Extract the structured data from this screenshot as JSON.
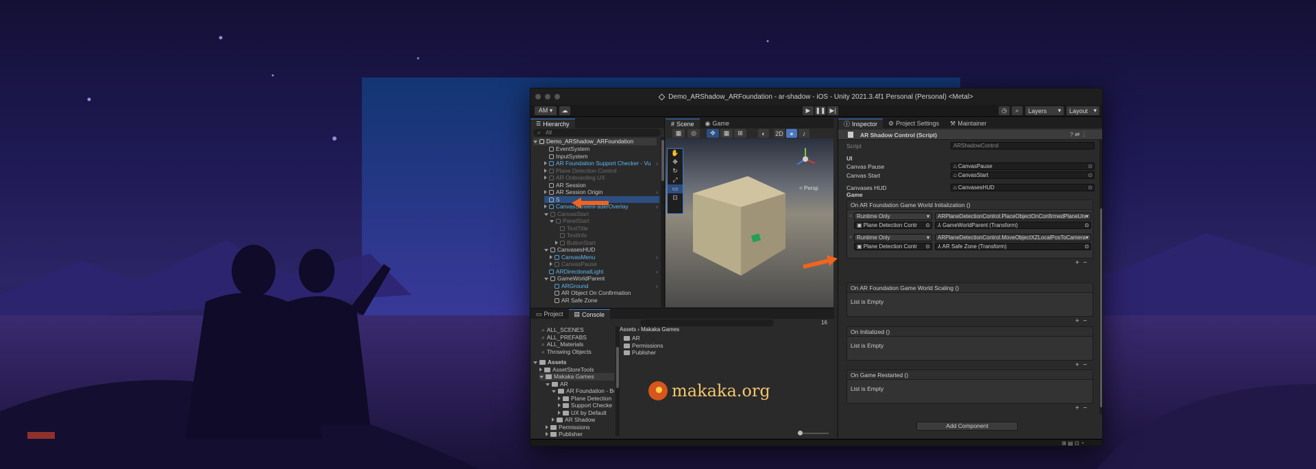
{
  "window": {
    "title": "Demo_ARShadow_ARFoundation - ar-shadow - iOS - Unity 2021.3.4f1 Personal (Personal) <Metal>"
  },
  "toolbar": {
    "account": "AM ▾",
    "layers": "Layers",
    "layout": "Layout"
  },
  "hierarchy": {
    "tab": "Hierarchy",
    "search": "All",
    "scene": "Demo_ARShadow_ARFoundation",
    "items": [
      {
        "label": "EventSystem"
      },
      {
        "label": "InputSystem"
      },
      {
        "label": "AR Foundation Support Checker - Vu"
      },
      {
        "label": "Plane Detection Control"
      },
      {
        "label": "AR Onboarding UX"
      },
      {
        "label": "AR Session"
      },
      {
        "label": "AR Session Origin"
      },
      {
        "label": "S"
      },
      {
        "label": "CanvasScreenFaderOverlay"
      },
      {
        "label": "CanvasStart"
      },
      {
        "label": "PanelStart"
      },
      {
        "label": "TextTitle"
      },
      {
        "label": "TextInfo"
      },
      {
        "label": "ButtonStart"
      },
      {
        "label": "CanvasesHUD"
      },
      {
        "label": "CanvasMenu"
      },
      {
        "label": "CanvasPause"
      },
      {
        "label": "ARDirectionalLight"
      },
      {
        "label": "GameWorldParent"
      },
      {
        "label": "ARGround"
      },
      {
        "label": "AR Object On Confirmation"
      },
      {
        "label": "AR Safe Zone"
      }
    ]
  },
  "scene": {
    "tabs": [
      "Scene",
      "Game"
    ],
    "mode_2d": "2D",
    "persp": "< Persp"
  },
  "project": {
    "tabs": [
      "Project",
      "Console"
    ],
    "count": "16",
    "favorites": [
      "ALL_SCENES",
      "ALL_PREFABS",
      "ALL_Materials",
      "Throwing Objects"
    ],
    "tree": [
      {
        "label": "Assets"
      },
      {
        "label": "AssetStoreTools"
      },
      {
        "label": "Makaka Games"
      },
      {
        "label": "AR"
      },
      {
        "label": "AR Foundation - Bu"
      },
      {
        "label": "Plane Detection"
      },
      {
        "label": "Support Checke"
      },
      {
        "label": "UX by Default"
      },
      {
        "label": "AR Shadow"
      },
      {
        "label": "Permissions"
      },
      {
        "label": "Publisher"
      }
    ],
    "breadcrumb": [
      "Assets",
      "Makaka Games"
    ],
    "folders": [
      "AR",
      "Permissions",
      "Publisher"
    ]
  },
  "watermark": "makaka.org",
  "inspector": {
    "tabs": [
      "Inspector",
      "Project Settings",
      "Maintainer"
    ],
    "component": "AR Shadow Control (Script)",
    "script_label": "Script",
    "script_value": "ARShadowControl",
    "section_ui": "UI",
    "fields": [
      {
        "label": "Canvas Pause",
        "value": "CanvasPause"
      },
      {
        "label": "Canvas Start",
        "value": "CanvasStart"
      },
      {
        "label": "Canvases HUD",
        "value": "CanvasesHUD"
      }
    ],
    "section_game": "Game",
    "events": [
      {
        "title": "On AR Foundation Game World Initialization ()",
        "listeners": [
          {
            "mode": "Runtime Only",
            "func": "ARPlaneDetectionControl.PlaceObjectOnConfirmedPlaneUnd",
            "target": "Plane Detection Contr",
            "arg": "GameWorldParent (Transform)"
          },
          {
            "mode": "Runtime Only",
            "func": "ARPlaneDetectionControl.MoveObjectXZLocalPosToCamera",
            "target": "Plane Detection Contr",
            "arg": "AR Safe Zone (Transform)"
          }
        ]
      },
      {
        "title": "On AR Foundation Game World Scaling ()",
        "empty": "List is Empty"
      },
      {
        "title": "On Initialized ()",
        "empty": "List is Empty"
      },
      {
        "title": "On Game Restarted ()",
        "empty": "List is Empty"
      }
    ],
    "add_component": "Add Component"
  },
  "colors": {
    "accent_orange": "#f0641e",
    "selection_blue": "#2d4e80",
    "prefab_blue": "#5fb6f0"
  }
}
